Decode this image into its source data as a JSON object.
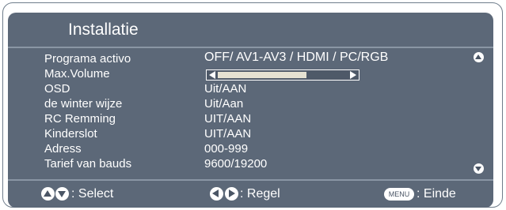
{
  "title": "Installatie",
  "rows": [
    {
      "label": "Programa activo",
      "value": "OFF/ AV1-AV3 / HDMI / PC/RGB"
    },
    {
      "label": "Max.Volume",
      "value": ""
    },
    {
      "label": "OSD",
      "value": "Uit/AAN"
    },
    {
      "label": "de winter wijze",
      "value": "Uit/Aan"
    },
    {
      "label": "RC Remming",
      "value": "UIT/AAN"
    },
    {
      "label": "Kinderslot",
      "value": "UIT/AAN"
    },
    {
      "label": "Adress",
      "value": "000-999"
    },
    {
      "label": "Tarief van bauds",
      "value": "9600/19200"
    }
  ],
  "slider": {
    "fraction": 0.68
  },
  "footer": {
    "select_label": ": Select",
    "adjust_label": ": Regel",
    "menu_key": "MENU",
    "exit_label": ": Einde"
  },
  "colors": {
    "panel": "#5c6878",
    "frame": "#6f7d8b",
    "text": "#ffffff"
  },
  "icons": [
    "scroll-up-icon",
    "scroll-down-icon",
    "nav-up-icon",
    "nav-down-icon",
    "nav-left-icon",
    "nav-right-icon",
    "menu-key-icon"
  ]
}
